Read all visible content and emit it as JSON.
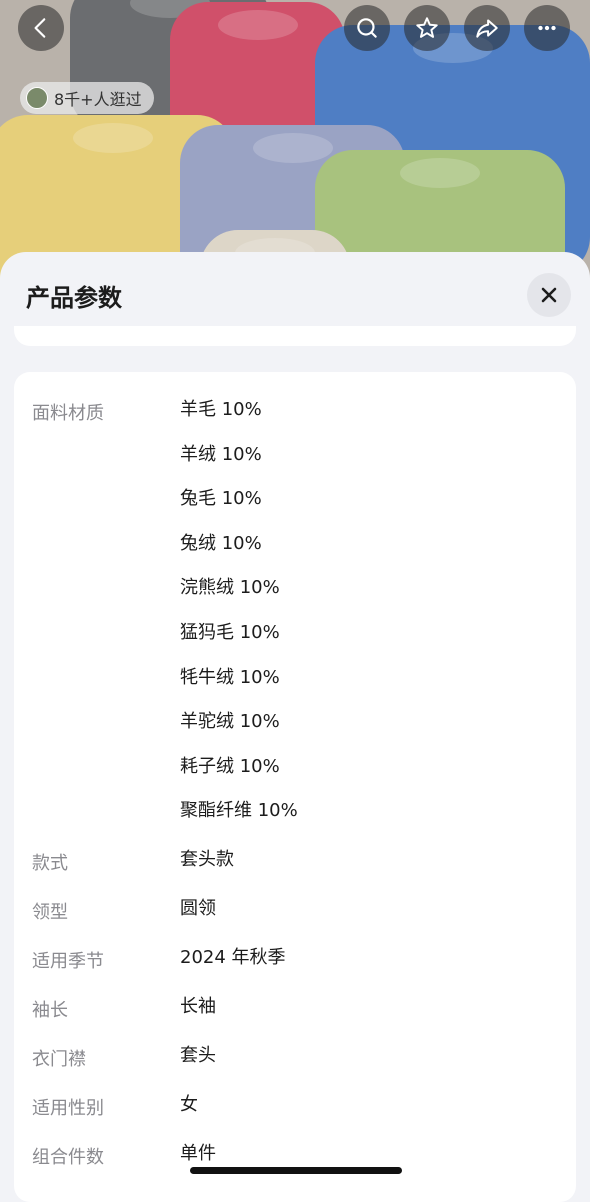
{
  "header": {
    "visitors_text": "8千+人逛过",
    "buttons": [
      "back-icon",
      "search-icon",
      "star-icon",
      "share-icon",
      "more-icon"
    ]
  },
  "sheet": {
    "title": "产品参数",
    "params": [
      {
        "label": "面料材质",
        "values": [
          "羊毛 10%",
          "羊绒 10%",
          "兔毛 10%",
          "兔绒 10%",
          "浣熊绒 10%",
          "猛犸毛 10%",
          "牦牛绒 10%",
          "羊驼绒 10%",
          "耗子绒 10%",
          "聚酯纤维 10%"
        ]
      },
      {
        "label": "款式",
        "values": [
          "套头款"
        ]
      },
      {
        "label": "领型",
        "values": [
          "圆领"
        ]
      },
      {
        "label": "适用季节",
        "values": [
          "2024 年秋季"
        ]
      },
      {
        "label": "袖长",
        "values": [
          "长袖"
        ]
      },
      {
        "label": "衣门襟",
        "values": [
          "套头"
        ]
      },
      {
        "label": "适用性别",
        "values": [
          "女"
        ]
      },
      {
        "label": "组合件数",
        "values": [
          "单件"
        ]
      }
    ]
  },
  "colors": {
    "sweaters": [
      "#6b6d70",
      "#d0506a",
      "#4f7ec4",
      "#e6cf7a",
      "#9aa3c4",
      "#a8c27e",
      "#ddd6c8"
    ]
  }
}
